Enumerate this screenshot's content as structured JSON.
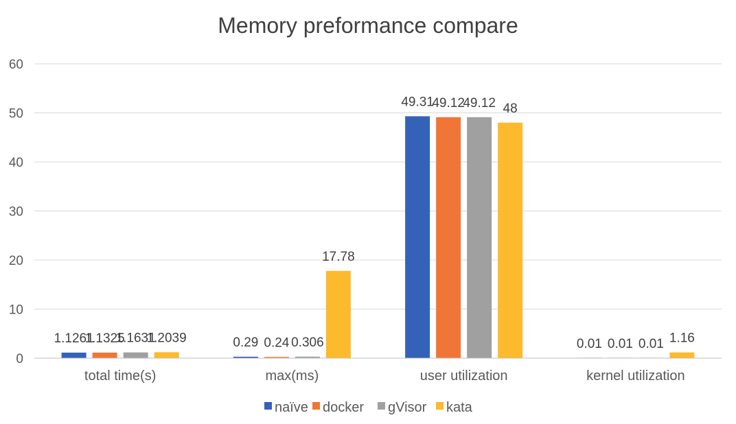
{
  "chart_data": {
    "type": "bar",
    "title": "Memory preformance compare",
    "categories": [
      "total time(s)",
      "max(ms)",
      "user utilization",
      "kernel utilization"
    ],
    "series": [
      {
        "name": "naïve",
        "color": "#3462B8",
        "values": [
          1.1261,
          0.29,
          49.31,
          0.01
        ],
        "labels": [
          "1.1261",
          "0.29",
          "49.31",
          "0.01"
        ]
      },
      {
        "name": "docker",
        "color": "#F07637",
        "values": [
          1.1325,
          0.24,
          49.12,
          0.01
        ],
        "labels": [
          "1.1325",
          "0.24",
          "49.12",
          "0.01"
        ]
      },
      {
        "name": "gVisor",
        "color": "#A0A0A0",
        "values": [
          1.1631,
          0.306,
          49.12,
          0.01
        ],
        "labels": [
          "1.1631",
          "0.306",
          "49.12",
          "0.01"
        ]
      },
      {
        "name": "kata",
        "color": "#FDBA2C",
        "values": [
          1.2039,
          17.78,
          48,
          1.16
        ],
        "labels": [
          "1.2039",
          "17.78",
          "48",
          "1.16"
        ]
      }
    ],
    "ylim": [
      0,
      60
    ],
    "yticks": [
      0,
      10,
      20,
      30,
      40,
      50,
      60
    ],
    "xlabel": "",
    "ylabel": "",
    "grid": true,
    "legend": "bottom"
  }
}
